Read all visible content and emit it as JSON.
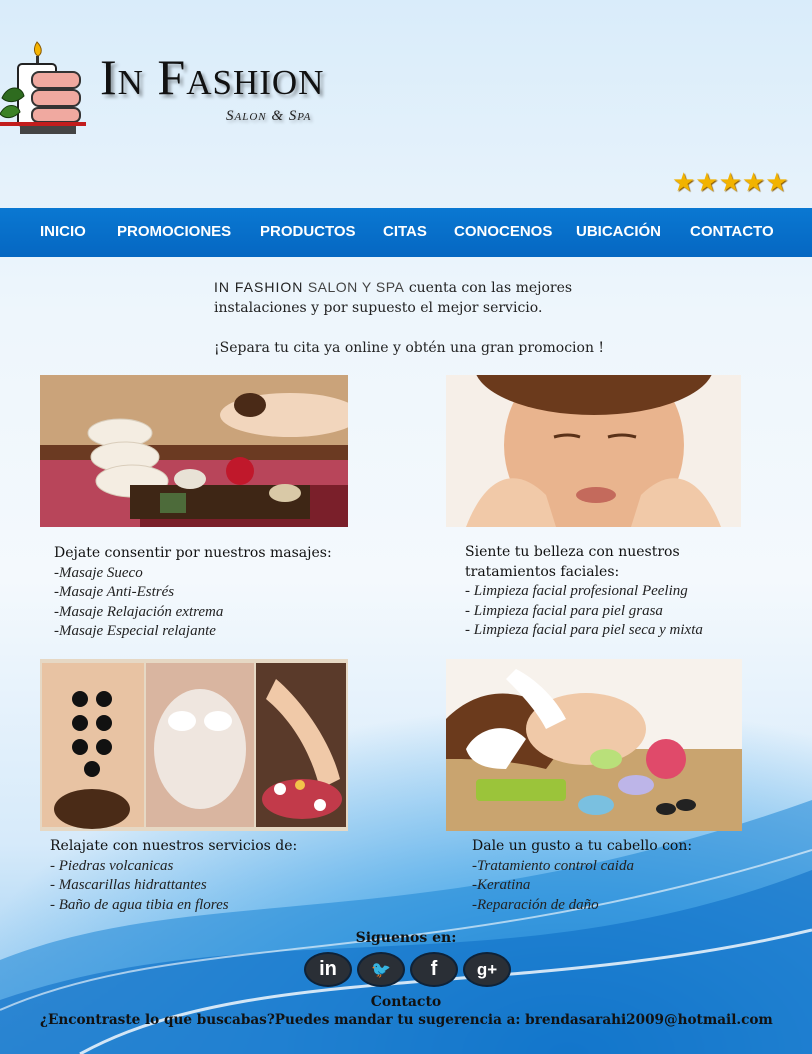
{
  "header": {
    "title": "In Fashion",
    "subtitle": "Salon & Spa",
    "rating": "★★★★★"
  },
  "nav": {
    "items": [
      "INICIO",
      "PROMOCIONES",
      "PRODUCTOS",
      "CITAS",
      "CONOCENOS",
      "UBICACIÓN",
      "CONTACTO"
    ]
  },
  "intro": {
    "brand": "IN  FASHION",
    "brand_sub": "SALON Y SPA",
    "line1_rest": " cuenta con las mejores",
    "line2": "instalaciones y por supuesto el mejor servicio.",
    "promo": "¡Separa tu cita ya online y obtén una gran promocion !"
  },
  "services": {
    "massage": {
      "heading": "Dejate consentir por nuestros masajes:",
      "items": [
        "-Masaje Sueco",
        "-Masaje Anti-Estrés",
        "-Masaje Relajación extrema",
        "-Masaje Especial relajante"
      ]
    },
    "facial": {
      "heading": "Siente tu belleza con nuestros tratamientos faciales:",
      "items": [
        "- Limpieza facial profesional Peeling",
        "- Limpieza facial para piel grasa",
        "- Limpieza facial para piel seca y mixta"
      ]
    },
    "relax": {
      "heading": "Relajate con nuestros servicios de:",
      "items": [
        "- Piedras volcanicas",
        "- Mascarillas hidrattantes",
        "- Baño de agua tibia en flores"
      ]
    },
    "hair": {
      "heading": "Dale un gusto a tu cabello con:",
      "items": [
        "-Tratamiento control caida",
        "-Keratina",
        "-Reparación de daño"
      ]
    }
  },
  "footer": {
    "follow": "Siguenos en:",
    "social": [
      {
        "icon": "linkedin-icon",
        "glyph": "in"
      },
      {
        "icon": "twitter-icon",
        "glyph": "🐦"
      },
      {
        "icon": "facebook-icon",
        "glyph": "f"
      },
      {
        "icon": "googleplus-icon",
        "glyph": "g+"
      }
    ],
    "contact_heading": "Contacto",
    "contact_text": "¿Encontraste lo que buscabas?Puedes mandar tu sugerencia a: brendasarahi2009@hotmail.com"
  },
  "colors": {
    "nav_bg": "#0a78d2",
    "star": "#f2b300",
    "background": "#eef6fc"
  }
}
